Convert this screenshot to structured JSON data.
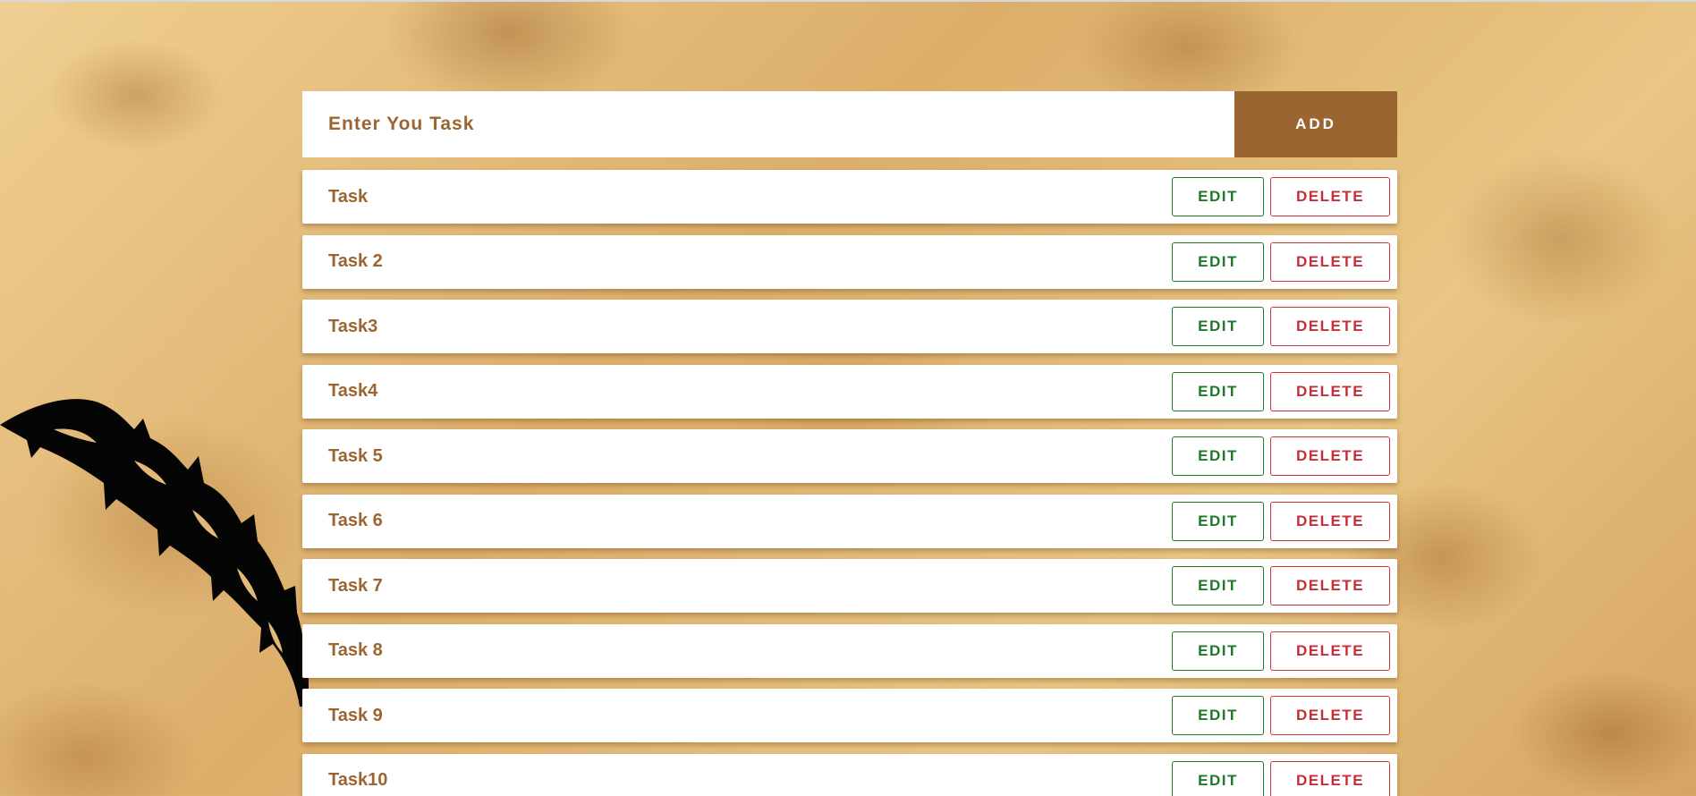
{
  "input": {
    "placeholder": "Enter You Task",
    "value": ""
  },
  "add_button_label": "ADD",
  "tasks": [
    {
      "label": "Task",
      "edit_label": "EDIT",
      "delete_label": "DELETE"
    },
    {
      "label": "Task 2",
      "edit_label": "EDIT",
      "delete_label": "DELETE"
    },
    {
      "label": "Task3",
      "edit_label": "EDIT",
      "delete_label": "DELETE"
    },
    {
      "label": "Task4",
      "edit_label": "EDIT",
      "delete_label": "DELETE"
    },
    {
      "label": "Task 5",
      "edit_label": "EDIT",
      "delete_label": "DELETE"
    },
    {
      "label": "Task 6",
      "edit_label": "EDIT",
      "delete_label": "DELETE"
    },
    {
      "label": "Task 7",
      "edit_label": "EDIT",
      "delete_label": "DELETE"
    },
    {
      "label": "Task 8",
      "edit_label": "EDIT",
      "delete_label": "DELETE"
    },
    {
      "label": "Task 9",
      "edit_label": "EDIT",
      "delete_label": "DELETE"
    },
    {
      "label": "Task10",
      "edit_label": "EDIT",
      "delete_label": "DELETE"
    }
  ],
  "icons": {
    "decoration": "feather-quill-icon"
  },
  "colors": {
    "accent": "#9a6531",
    "edit": "#1e7a28",
    "delete": "#c4303a",
    "background": "#e2b979"
  }
}
